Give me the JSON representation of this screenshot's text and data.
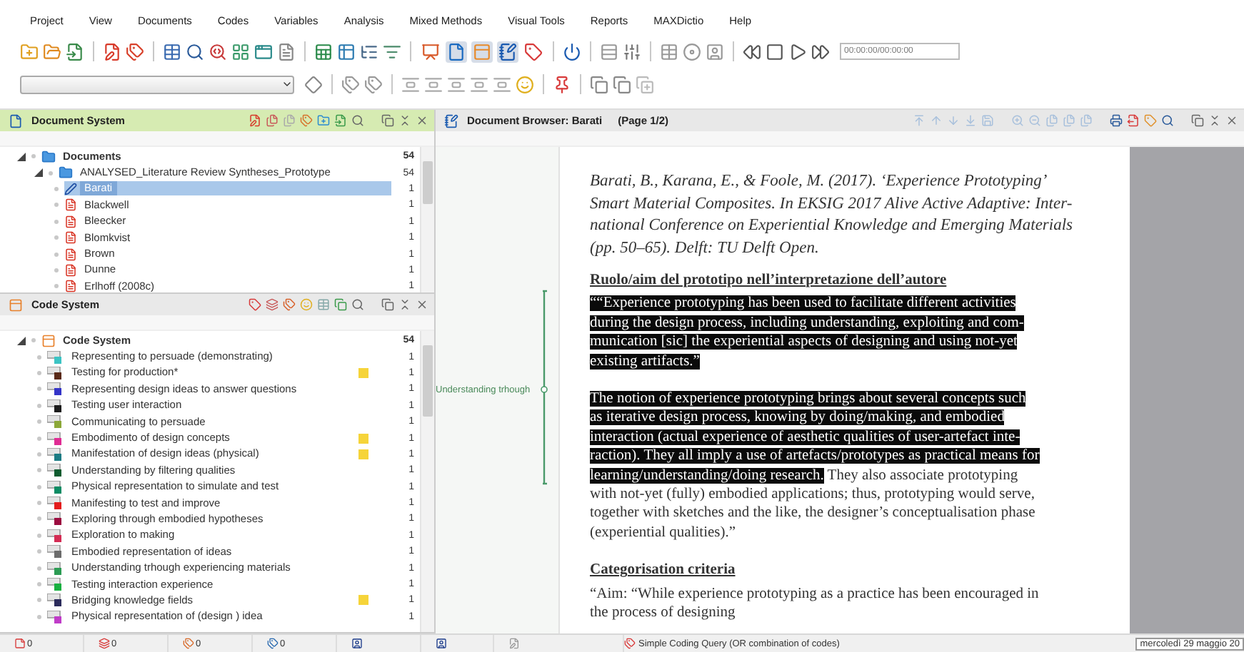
{
  "menu": [
    {
      "label": "Project"
    },
    {
      "label": "View"
    },
    {
      "label": "Documents"
    },
    {
      "label": "Codes"
    },
    {
      "label": "Variables"
    },
    {
      "label": "Analysis"
    },
    {
      "label": "Mixed Methods"
    },
    {
      "label": "Visual Tools"
    },
    {
      "label": "Reports"
    },
    {
      "label": "MAXDictio"
    },
    {
      "label": "Help"
    }
  ],
  "toolbar": {
    "toggles": [
      {
        "on": false
      },
      {
        "on": true
      },
      {
        "on": true
      },
      {
        "on": true
      },
      {
        "on": false
      }
    ],
    "timecode": "00:00:00/00:00:00"
  },
  "document_system": {
    "title": "Document System",
    "tree": [
      {
        "label": "Documents",
        "count": "54",
        "kind": "folder",
        "expanded": true,
        "selected": false,
        "children": [
          {
            "label": "ANALYSED_Literature Review Syntheses_Prototype",
            "count": "54",
            "kind": "folder",
            "expanded": true,
            "selected": false,
            "children": [
              {
                "label": "Barati",
                "count": "1",
                "kind": "edited",
                "selected": true
              },
              {
                "label": "Blackwell",
                "count": "1",
                "kind": "pdf",
                "selected": false
              },
              {
                "label": "Bleecker",
                "count": "1",
                "kind": "pdf",
                "selected": false
              },
              {
                "label": "Blomkvist",
                "count": "1",
                "kind": "pdf",
                "selected": false
              },
              {
                "label": "Brown",
                "count": "1",
                "kind": "pdf",
                "selected": false
              },
              {
                "label": "Dunne",
                "count": "1",
                "kind": "pdf",
                "selected": false
              },
              {
                "label": "Erlhoff (2008c)",
                "count": "1",
                "kind": "pdf",
                "selected": false
              }
            ]
          }
        ]
      }
    ]
  },
  "code_system": {
    "title": "Code System",
    "root": {
      "label": "Code System",
      "count": "54",
      "expanded": true
    },
    "codes": [
      {
        "label": "Representing to persuade (demonstrating)",
        "color": "#3cc4c4",
        "memo": false,
        "count": "1"
      },
      {
        "label": "Testing for production*",
        "color": "#5a2a18",
        "memo": true,
        "count": "1"
      },
      {
        "label": "Representing design ideas to answer questions",
        "color": "#3434c8",
        "memo": false,
        "count": "1"
      },
      {
        "label": "Testing user interaction",
        "color": "#1c1c1c",
        "memo": false,
        "count": "1"
      },
      {
        "label": "Communicating to persuade",
        "color": "#8ca838",
        "memo": false,
        "count": "1"
      },
      {
        "label": "Embodimento of design concepts",
        "color": "#e02c94",
        "memo": true,
        "count": "1"
      },
      {
        "label": "Manifestation of design ideas (physical)",
        "color": "#1c7c84",
        "memo": true,
        "count": "1"
      },
      {
        "label": "Understanding by filtering qualities",
        "color": "#105c30",
        "memo": false,
        "count": "1"
      },
      {
        "label": "Physical representation to simulate and test",
        "color": "#0c8c64",
        "memo": false,
        "count": "1"
      },
      {
        "label": "Manifesting to test and improve",
        "color": "#e41c1c",
        "memo": false,
        "count": "1"
      },
      {
        "label": "Exploring through embodied hypotheses",
        "color": "#9c0c40",
        "memo": false,
        "count": "1"
      },
      {
        "label": "Exploration to making",
        "color": "#d42c54",
        "memo": false,
        "count": "1"
      },
      {
        "label": "Embodied representation of ideas",
        "color": "#6c6c6c",
        "memo": false,
        "count": "1"
      },
      {
        "label": "Understanding trhough experiencing materials",
        "color": "#2c9c54",
        "memo": false,
        "count": "1"
      },
      {
        "label": "Testing interaction experience",
        "color": "#18b040",
        "memo": false,
        "count": "1"
      },
      {
        "label": "Bridging knowledge fields",
        "color": "#2c2c5c",
        "memo": true,
        "count": "1"
      },
      {
        "label": "Physical representation of (design ) idea",
        "color": "#c03cc8",
        "memo": false,
        "count": "1"
      }
    ]
  },
  "document_browser": {
    "title": "Document Browser: Barati",
    "page": "(Page 1/2)",
    "coding_stripe": {
      "label": "Understanding trhough"
    },
    "blocks": [
      {
        "kind": "citation",
        "lines": [
          [
            {
              "text": "Barati, B., Karana, E., & Foole, M. (2017). ‘Experience Prototyping’",
              "highlighted": false
            }
          ],
          [
            {
              "text": "Smart Material Composites. In EKSIG 2017 Alive Active Adaptive: Inter-",
              "highlighted": false
            }
          ],
          [
            {
              "text": "national Conference on Experiential Knowledge and Emerging Materials",
              "highlighted": false
            }
          ],
          [
            {
              "text": "(pp. 50–65). Delft: TU Delft Open.",
              "highlighted": false
            }
          ]
        ]
      },
      {
        "kind": "heading",
        "lines": [
          [
            {
              "text": "Ruolo/aim del prototipo nell’interpretazione dell’autore",
              "highlighted": false
            }
          ]
        ]
      },
      {
        "kind": "paragraph",
        "lines": [
          [
            {
              "text": "““Experience prototyping has been used to facilitate different activities",
              "highlighted": true
            }
          ],
          [
            {
              "text": "during the design process, including understanding, exploiting and com-",
              "highlighted": true
            }
          ],
          [
            {
              "text": "munication [sic] the experiential aspects of designing and using not-yet",
              "highlighted": true
            }
          ],
          [
            {
              "text": "existing artifacts.”",
              "highlighted": true
            }
          ]
        ]
      },
      {
        "kind": "paragraph",
        "lines": [
          [
            {
              "text": "The notion of experience prototyping brings about several concepts such",
              "highlighted": true
            }
          ],
          [
            {
              "text": "as iterative design process, knowing by doing/making, and embodied",
              "highlighted": true
            }
          ],
          [
            {
              "text": "interaction (actual experience of aesthetic qualities of user-artefact inte-",
              "highlighted": true
            }
          ],
          [
            {
              "text": "raction). They all imply a use of artefacts/prototypes as practical means for",
              "highlighted": true
            }
          ],
          [
            {
              "text": "learning/understanding/doing research.",
              "highlighted": true
            },
            {
              "text": " They also associate prototyping",
              "highlighted": false
            }
          ],
          [
            {
              "text": "with not-yet (fully) embodied applications; thus, prototyping would serve,",
              "highlighted": false
            }
          ],
          [
            {
              "text": "together with sketches and the like, the designer’s conceptualisation phase",
              "highlighted": false
            }
          ],
          [
            {
              "text": "(experiential qualities).”",
              "highlighted": false
            }
          ]
        ]
      },
      {
        "kind": "heading",
        "lines": [
          [
            {
              "text": "Categorisation criteria",
              "highlighted": false
            }
          ]
        ]
      },
      {
        "kind": "body",
        "lines": [
          [
            {
              "text": "“Aim: “While experience prototyping as a practice has been encouraged in",
              "highlighted": false
            }
          ],
          [
            {
              "text": "the process of designing",
              "highlighted": false
            }
          ]
        ]
      }
    ]
  },
  "status_bar": {
    "counts": [
      "0",
      "0",
      "0",
      "0"
    ],
    "query": "Simple Coding Query (OR combination of codes)",
    "date": "mercoledì 29 maggio 20"
  }
}
